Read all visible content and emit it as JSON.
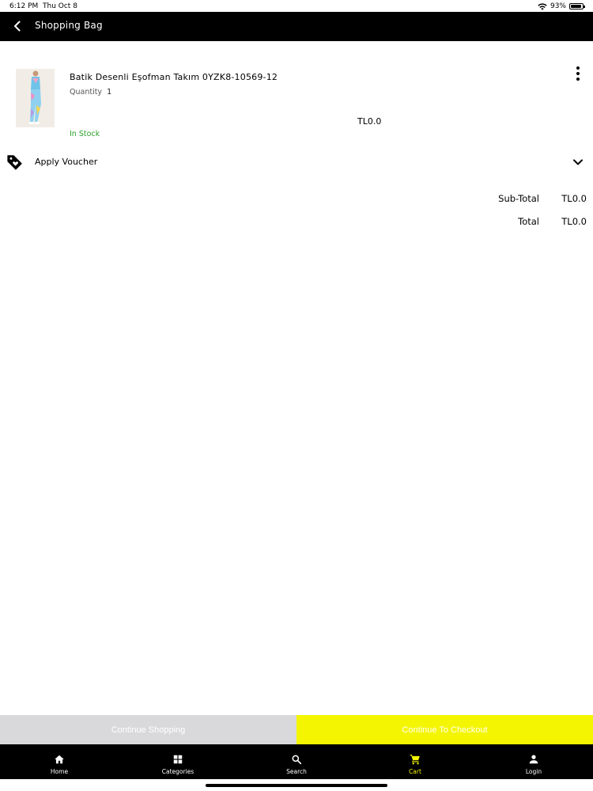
{
  "status_bar": {
    "time": "6:12 PM",
    "date": "Thu Oct 8",
    "battery": "93%",
    "battery_level": 0.93
  },
  "header": {
    "title": "Shopping Bag",
    "back_icon": "chevron-left-icon"
  },
  "cart": {
    "items": [
      {
        "name": "Batik Desenli Eşofman Takım 0YZK8-10569-12",
        "quantity_label": "Quantity",
        "quantity": "1",
        "price": "TL0.0",
        "stock_status": "In Stock",
        "stock_color": "#2ca02c",
        "menu_icon": "more-vertical-icon"
      }
    ]
  },
  "voucher": {
    "label": "Apply Voucher",
    "icon": "tag-icon",
    "expand_icon": "chevron-down-icon"
  },
  "summary": {
    "subtotal_label": "Sub-Total",
    "subtotal_value": "TL0.0",
    "total_label": "Total",
    "total_value": "TL0.0"
  },
  "actions": {
    "continue_shopping": "Continue Shopping",
    "checkout": "Continue To Checkout",
    "checkout_color": "#f4f500"
  },
  "tab_bar": {
    "tabs": [
      {
        "label": "Home",
        "icon": "home-icon"
      },
      {
        "label": "Categories",
        "icon": "grid-icon"
      },
      {
        "label": "Search",
        "icon": "search-icon"
      },
      {
        "label": "Cart",
        "icon": "cart-icon",
        "active": true
      },
      {
        "label": "Login",
        "icon": "user-icon"
      }
    ],
    "active_color": "#f4f500"
  }
}
